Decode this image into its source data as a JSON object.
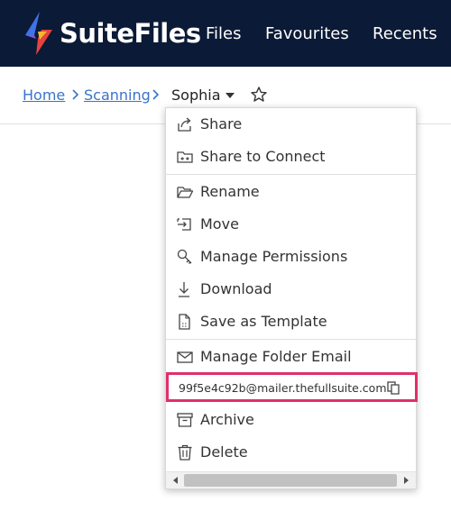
{
  "header": {
    "brand": "SuiteFiles",
    "nav": [
      "Files",
      "Favourites",
      "Recents"
    ],
    "colors": {
      "bar": "#0b1a36",
      "logo_blue": "#3f73e8",
      "logo_red": "#e8423f",
      "logo_yellow": "#f5b82e"
    }
  },
  "breadcrumb": {
    "items": [
      "Home",
      "Scanning"
    ],
    "current": "Sophia"
  },
  "menu": {
    "items": [
      {
        "label": "Share",
        "icon": "share-icon"
      },
      {
        "label": "Share to Connect",
        "icon": "share-connect-icon"
      },
      {
        "label": "Rename",
        "icon": "folder-open-icon"
      },
      {
        "label": "Move",
        "icon": "move-icon"
      },
      {
        "label": "Manage Permissions",
        "icon": "key-icon"
      },
      {
        "label": "Download",
        "icon": "download-icon"
      },
      {
        "label": "Save as Template",
        "icon": "template-icon"
      },
      {
        "label": "Manage Folder Email",
        "icon": "mail-icon"
      },
      {
        "label": "Archive",
        "icon": "archive-icon"
      },
      {
        "label": "Delete",
        "icon": "trash-icon"
      }
    ],
    "folder_email": "99f5e4c92b@mailer.thefullsuite.com",
    "highlight_color": "#e0306a"
  }
}
